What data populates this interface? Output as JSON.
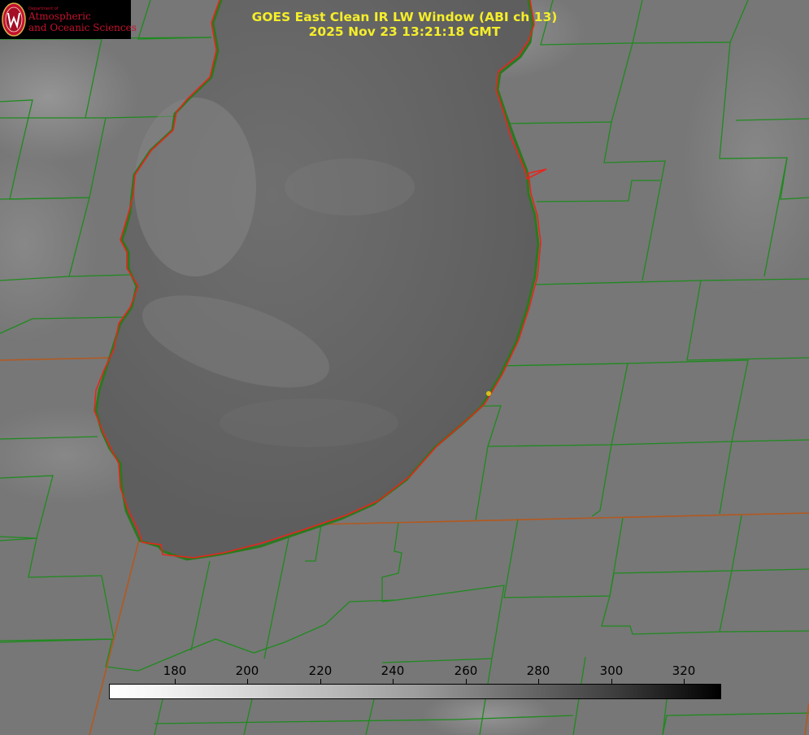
{
  "logo": {
    "department": "Department of",
    "line1": "Atmospheric",
    "line2": "and Oceanic Sciences"
  },
  "title": {
    "line1": "GOES East Clean IR LW Window (ABI ch 13)",
    "line2": "2025 Nov 23 13:21:18 GMT"
  },
  "colorbar": {
    "ticks": [
      "180",
      "200",
      "220",
      "240",
      "260",
      "280",
      "300",
      "320"
    ]
  },
  "colors": {
    "title": "#f5ee2a",
    "county_lines": "#1e8a1e",
    "state_lines": "#b4581e",
    "shoreline": "#e8251c",
    "station_marker": "#d8c21a",
    "logo_text": "#c5102e"
  }
}
